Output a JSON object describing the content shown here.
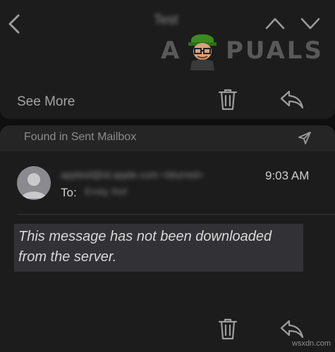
{
  "nav": {
    "title": "Test",
    "icons": [
      "chevron-left-icon",
      "chevron-up-icon",
      "chevron-down-icon"
    ]
  },
  "logo": {
    "text_left": "A",
    "text_right": "PUALS"
  },
  "thread_card": {
    "see_more_label": "See More",
    "icons": [
      "trash-icon",
      "reply-icon"
    ]
  },
  "message_card": {
    "mailbox_label": "Found in Sent Mailbox",
    "sender": "appleid@id.apple.com <blurred>",
    "time": "9:03 AM",
    "to_label": "To:",
    "to_value": "Emily Ref",
    "body": "This message has not been downloaded from the server.",
    "icons": [
      "paper-plane-icon",
      "trash-icon",
      "reply-icon"
    ]
  },
  "watermark": "wsxdn.com",
  "colors": {
    "background": "#0f0f10",
    "card": "#1c1c1d",
    "card_header": "#252526",
    "message_highlight": "#323236",
    "icon_gray": "#9c9c9c"
  }
}
